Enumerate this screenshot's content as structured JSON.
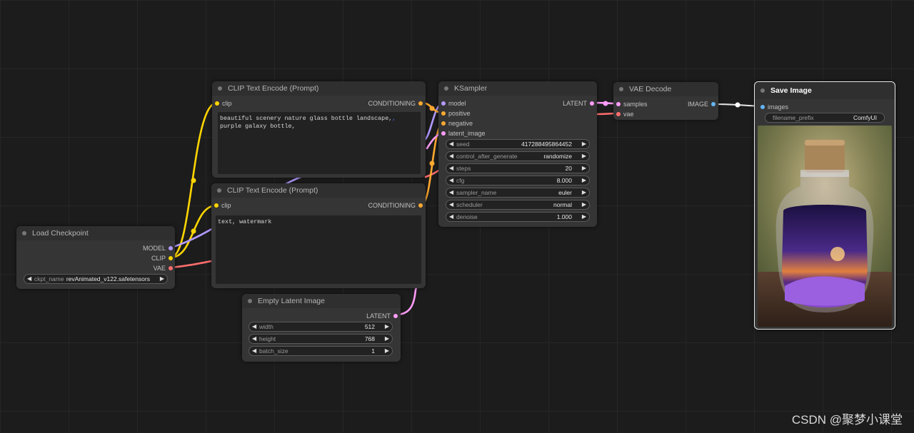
{
  "colors": {
    "model": "#b29aff",
    "clip": "#ffd500",
    "vae": "#ff6e6e",
    "conditioning": "#ffa931",
    "latent": "#ff9cf9",
    "image": "#64b5f6"
  },
  "load_checkpoint": {
    "title": "Load Checkpoint",
    "outputs": [
      "MODEL",
      "CLIP",
      "VAE"
    ],
    "ckpt_label": "ckpt_name",
    "ckpt_value": "revAnimated_v122.safetensors"
  },
  "clip_pos": {
    "title": "CLIP Text Encode (Prompt)",
    "input": "clip",
    "output": "CONDITIONING",
    "text_a": "beautiful scenery nature glass bottle landscape,",
    "text_emb": ",",
    "text_b": " purple galaxy bottle,"
  },
  "clip_neg": {
    "title": "CLIP Text Encode (Prompt)",
    "input": "clip",
    "output": "CONDITIONING",
    "text": "text, watermark"
  },
  "empty_latent": {
    "title": "Empty Latent Image",
    "output": "LATENT",
    "widgets": [
      {
        "label": "width",
        "value": "512"
      },
      {
        "label": "height",
        "value": "768"
      },
      {
        "label": "batch_size",
        "value": "1"
      }
    ]
  },
  "ksampler": {
    "title": "KSampler",
    "inputs": [
      "model",
      "positive",
      "negative",
      "latent_image"
    ],
    "output": "LATENT",
    "widgets": [
      {
        "label": "seed",
        "value": "417288495864452"
      },
      {
        "label": "control_after_generate",
        "value": "randomize"
      },
      {
        "label": "steps",
        "value": "20"
      },
      {
        "label": "cfg",
        "value": "8.000"
      },
      {
        "label": "sampler_name",
        "value": "euler"
      },
      {
        "label": "scheduler",
        "value": "normal"
      },
      {
        "label": "denoise",
        "value": "1.000"
      }
    ]
  },
  "vae_decode": {
    "title": "VAE Decode",
    "inputs": [
      "samples",
      "vae"
    ],
    "output": "IMAGE"
  },
  "save_image": {
    "title": "Save Image",
    "input": "images",
    "prefix_label": "filename_prefix",
    "prefix_value": "ComfyUI"
  },
  "watermark": "CSDN @聚梦小课堂"
}
